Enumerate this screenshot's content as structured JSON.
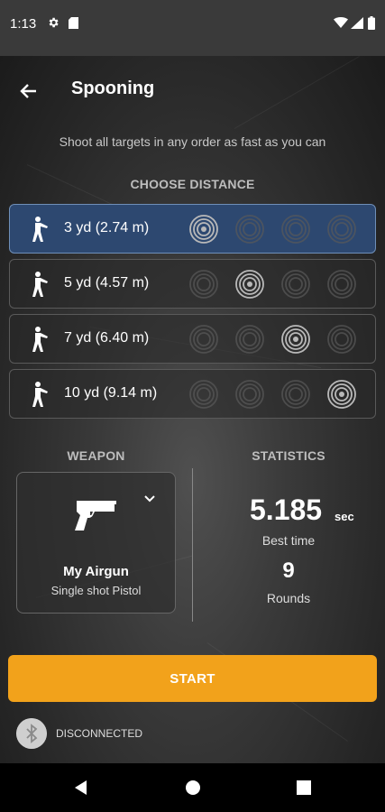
{
  "status_bar": {
    "time": "1:13",
    "icons": [
      "gear-icon",
      "sd-card-icon",
      "wifi-icon",
      "signal-icon",
      "battery-icon"
    ]
  },
  "header": {
    "title": "Spooning",
    "back_icon": "arrow-left-icon"
  },
  "subtitle": "Shoot all targets in any order as fast as you can",
  "distance": {
    "heading": "CHOOSE DISTANCE",
    "options": [
      {
        "label": "3 yd (2.74 m)",
        "selected": true,
        "active_target": 1
      },
      {
        "label": "5 yd (4.57 m)",
        "selected": false,
        "active_target": 2
      },
      {
        "label": "7 yd (6.40 m)",
        "selected": false,
        "active_target": 3
      },
      {
        "label": "10 yd (9.14 m)",
        "selected": false,
        "active_target": 4
      }
    ]
  },
  "weapon": {
    "heading": "WEAPON",
    "name": "My Airgun",
    "type": "Single shot Pistol",
    "icon": "pistol-icon"
  },
  "statistics": {
    "heading": "STATISTICS",
    "best_time_value": "5.185",
    "best_time_unit": "sec",
    "best_time_label": "Best time",
    "rounds_value": "9",
    "rounds_label": "Rounds"
  },
  "start_label": "START",
  "bluetooth": {
    "status": "DISCONNECTED",
    "icon": "bluetooth-icon"
  },
  "colors": {
    "accent": "#f2a21b",
    "selected_row": "#2d4870"
  },
  "nav": [
    "back-triangle-icon",
    "home-circle-icon",
    "recents-square-icon"
  ]
}
